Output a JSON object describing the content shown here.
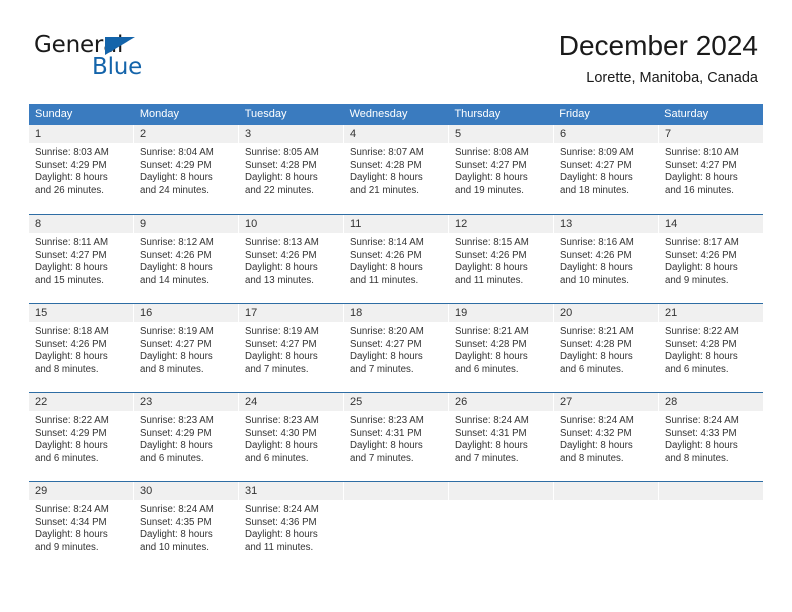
{
  "brand": {
    "line1": "General",
    "line2": "Blue",
    "accent_color": "#1464aa",
    "triangle_icon": "triangle-icon"
  },
  "header": {
    "title": "December 2024",
    "subtitle": "Lorette, Manitoba, Canada"
  },
  "calendar": {
    "header_bg": "#3a7bbf",
    "row_border": "#2e6da4",
    "daynum_bg": "#f0f0f0",
    "weekdays": [
      "Sunday",
      "Monday",
      "Tuesday",
      "Wednesday",
      "Thursday",
      "Friday",
      "Saturday"
    ],
    "weeks": [
      [
        {
          "day": "1",
          "sunrise": "Sunrise: 8:03 AM",
          "sunset": "Sunset: 4:29 PM",
          "daylight1": "Daylight: 8 hours",
          "daylight2": "and 26 minutes."
        },
        {
          "day": "2",
          "sunrise": "Sunrise: 8:04 AM",
          "sunset": "Sunset: 4:29 PM",
          "daylight1": "Daylight: 8 hours",
          "daylight2": "and 24 minutes."
        },
        {
          "day": "3",
          "sunrise": "Sunrise: 8:05 AM",
          "sunset": "Sunset: 4:28 PM",
          "daylight1": "Daylight: 8 hours",
          "daylight2": "and 22 minutes."
        },
        {
          "day": "4",
          "sunrise": "Sunrise: 8:07 AM",
          "sunset": "Sunset: 4:28 PM",
          "daylight1": "Daylight: 8 hours",
          "daylight2": "and 21 minutes."
        },
        {
          "day": "5",
          "sunrise": "Sunrise: 8:08 AM",
          "sunset": "Sunset: 4:27 PM",
          "daylight1": "Daylight: 8 hours",
          "daylight2": "and 19 minutes."
        },
        {
          "day": "6",
          "sunrise": "Sunrise: 8:09 AM",
          "sunset": "Sunset: 4:27 PM",
          "daylight1": "Daylight: 8 hours",
          "daylight2": "and 18 minutes."
        },
        {
          "day": "7",
          "sunrise": "Sunrise: 8:10 AM",
          "sunset": "Sunset: 4:27 PM",
          "daylight1": "Daylight: 8 hours",
          "daylight2": "and 16 minutes."
        }
      ],
      [
        {
          "day": "8",
          "sunrise": "Sunrise: 8:11 AM",
          "sunset": "Sunset: 4:27 PM",
          "daylight1": "Daylight: 8 hours",
          "daylight2": "and 15 minutes."
        },
        {
          "day": "9",
          "sunrise": "Sunrise: 8:12 AM",
          "sunset": "Sunset: 4:26 PM",
          "daylight1": "Daylight: 8 hours",
          "daylight2": "and 14 minutes."
        },
        {
          "day": "10",
          "sunrise": "Sunrise: 8:13 AM",
          "sunset": "Sunset: 4:26 PM",
          "daylight1": "Daylight: 8 hours",
          "daylight2": "and 13 minutes."
        },
        {
          "day": "11",
          "sunrise": "Sunrise: 8:14 AM",
          "sunset": "Sunset: 4:26 PM",
          "daylight1": "Daylight: 8 hours",
          "daylight2": "and 11 minutes."
        },
        {
          "day": "12",
          "sunrise": "Sunrise: 8:15 AM",
          "sunset": "Sunset: 4:26 PM",
          "daylight1": "Daylight: 8 hours",
          "daylight2": "and 11 minutes."
        },
        {
          "day": "13",
          "sunrise": "Sunrise: 8:16 AM",
          "sunset": "Sunset: 4:26 PM",
          "daylight1": "Daylight: 8 hours",
          "daylight2": "and 10 minutes."
        },
        {
          "day": "14",
          "sunrise": "Sunrise: 8:17 AM",
          "sunset": "Sunset: 4:26 PM",
          "daylight1": "Daylight: 8 hours",
          "daylight2": "and 9 minutes."
        }
      ],
      [
        {
          "day": "15",
          "sunrise": "Sunrise: 8:18 AM",
          "sunset": "Sunset: 4:26 PM",
          "daylight1": "Daylight: 8 hours",
          "daylight2": "and 8 minutes."
        },
        {
          "day": "16",
          "sunrise": "Sunrise: 8:19 AM",
          "sunset": "Sunset: 4:27 PM",
          "daylight1": "Daylight: 8 hours",
          "daylight2": "and 8 minutes."
        },
        {
          "day": "17",
          "sunrise": "Sunrise: 8:19 AM",
          "sunset": "Sunset: 4:27 PM",
          "daylight1": "Daylight: 8 hours",
          "daylight2": "and 7 minutes."
        },
        {
          "day": "18",
          "sunrise": "Sunrise: 8:20 AM",
          "sunset": "Sunset: 4:27 PM",
          "daylight1": "Daylight: 8 hours",
          "daylight2": "and 7 minutes."
        },
        {
          "day": "19",
          "sunrise": "Sunrise: 8:21 AM",
          "sunset": "Sunset: 4:28 PM",
          "daylight1": "Daylight: 8 hours",
          "daylight2": "and 6 minutes."
        },
        {
          "day": "20",
          "sunrise": "Sunrise: 8:21 AM",
          "sunset": "Sunset: 4:28 PM",
          "daylight1": "Daylight: 8 hours",
          "daylight2": "and 6 minutes."
        },
        {
          "day": "21",
          "sunrise": "Sunrise: 8:22 AM",
          "sunset": "Sunset: 4:28 PM",
          "daylight1": "Daylight: 8 hours",
          "daylight2": "and 6 minutes."
        }
      ],
      [
        {
          "day": "22",
          "sunrise": "Sunrise: 8:22 AM",
          "sunset": "Sunset: 4:29 PM",
          "daylight1": "Daylight: 8 hours",
          "daylight2": "and 6 minutes."
        },
        {
          "day": "23",
          "sunrise": "Sunrise: 8:23 AM",
          "sunset": "Sunset: 4:29 PM",
          "daylight1": "Daylight: 8 hours",
          "daylight2": "and 6 minutes."
        },
        {
          "day": "24",
          "sunrise": "Sunrise: 8:23 AM",
          "sunset": "Sunset: 4:30 PM",
          "daylight1": "Daylight: 8 hours",
          "daylight2": "and 6 minutes."
        },
        {
          "day": "25",
          "sunrise": "Sunrise: 8:23 AM",
          "sunset": "Sunset: 4:31 PM",
          "daylight1": "Daylight: 8 hours",
          "daylight2": "and 7 minutes."
        },
        {
          "day": "26",
          "sunrise": "Sunrise: 8:24 AM",
          "sunset": "Sunset: 4:31 PM",
          "daylight1": "Daylight: 8 hours",
          "daylight2": "and 7 minutes."
        },
        {
          "day": "27",
          "sunrise": "Sunrise: 8:24 AM",
          "sunset": "Sunset: 4:32 PM",
          "daylight1": "Daylight: 8 hours",
          "daylight2": "and 8 minutes."
        },
        {
          "day": "28",
          "sunrise": "Sunrise: 8:24 AM",
          "sunset": "Sunset: 4:33 PM",
          "daylight1": "Daylight: 8 hours",
          "daylight2": "and 8 minutes."
        }
      ],
      [
        {
          "day": "29",
          "sunrise": "Sunrise: 8:24 AM",
          "sunset": "Sunset: 4:34 PM",
          "daylight1": "Daylight: 8 hours",
          "daylight2": "and 9 minutes."
        },
        {
          "day": "30",
          "sunrise": "Sunrise: 8:24 AM",
          "sunset": "Sunset: 4:35 PM",
          "daylight1": "Daylight: 8 hours",
          "daylight2": "and 10 minutes."
        },
        {
          "day": "31",
          "sunrise": "Sunrise: 8:24 AM",
          "sunset": "Sunset: 4:36 PM",
          "daylight1": "Daylight: 8 hours",
          "daylight2": "and 11 minutes."
        },
        {
          "day": "",
          "sunrise": "",
          "sunset": "",
          "daylight1": "",
          "daylight2": ""
        },
        {
          "day": "",
          "sunrise": "",
          "sunset": "",
          "daylight1": "",
          "daylight2": ""
        },
        {
          "day": "",
          "sunrise": "",
          "sunset": "",
          "daylight1": "",
          "daylight2": ""
        },
        {
          "day": "",
          "sunrise": "",
          "sunset": "",
          "daylight1": "",
          "daylight2": ""
        }
      ]
    ]
  }
}
